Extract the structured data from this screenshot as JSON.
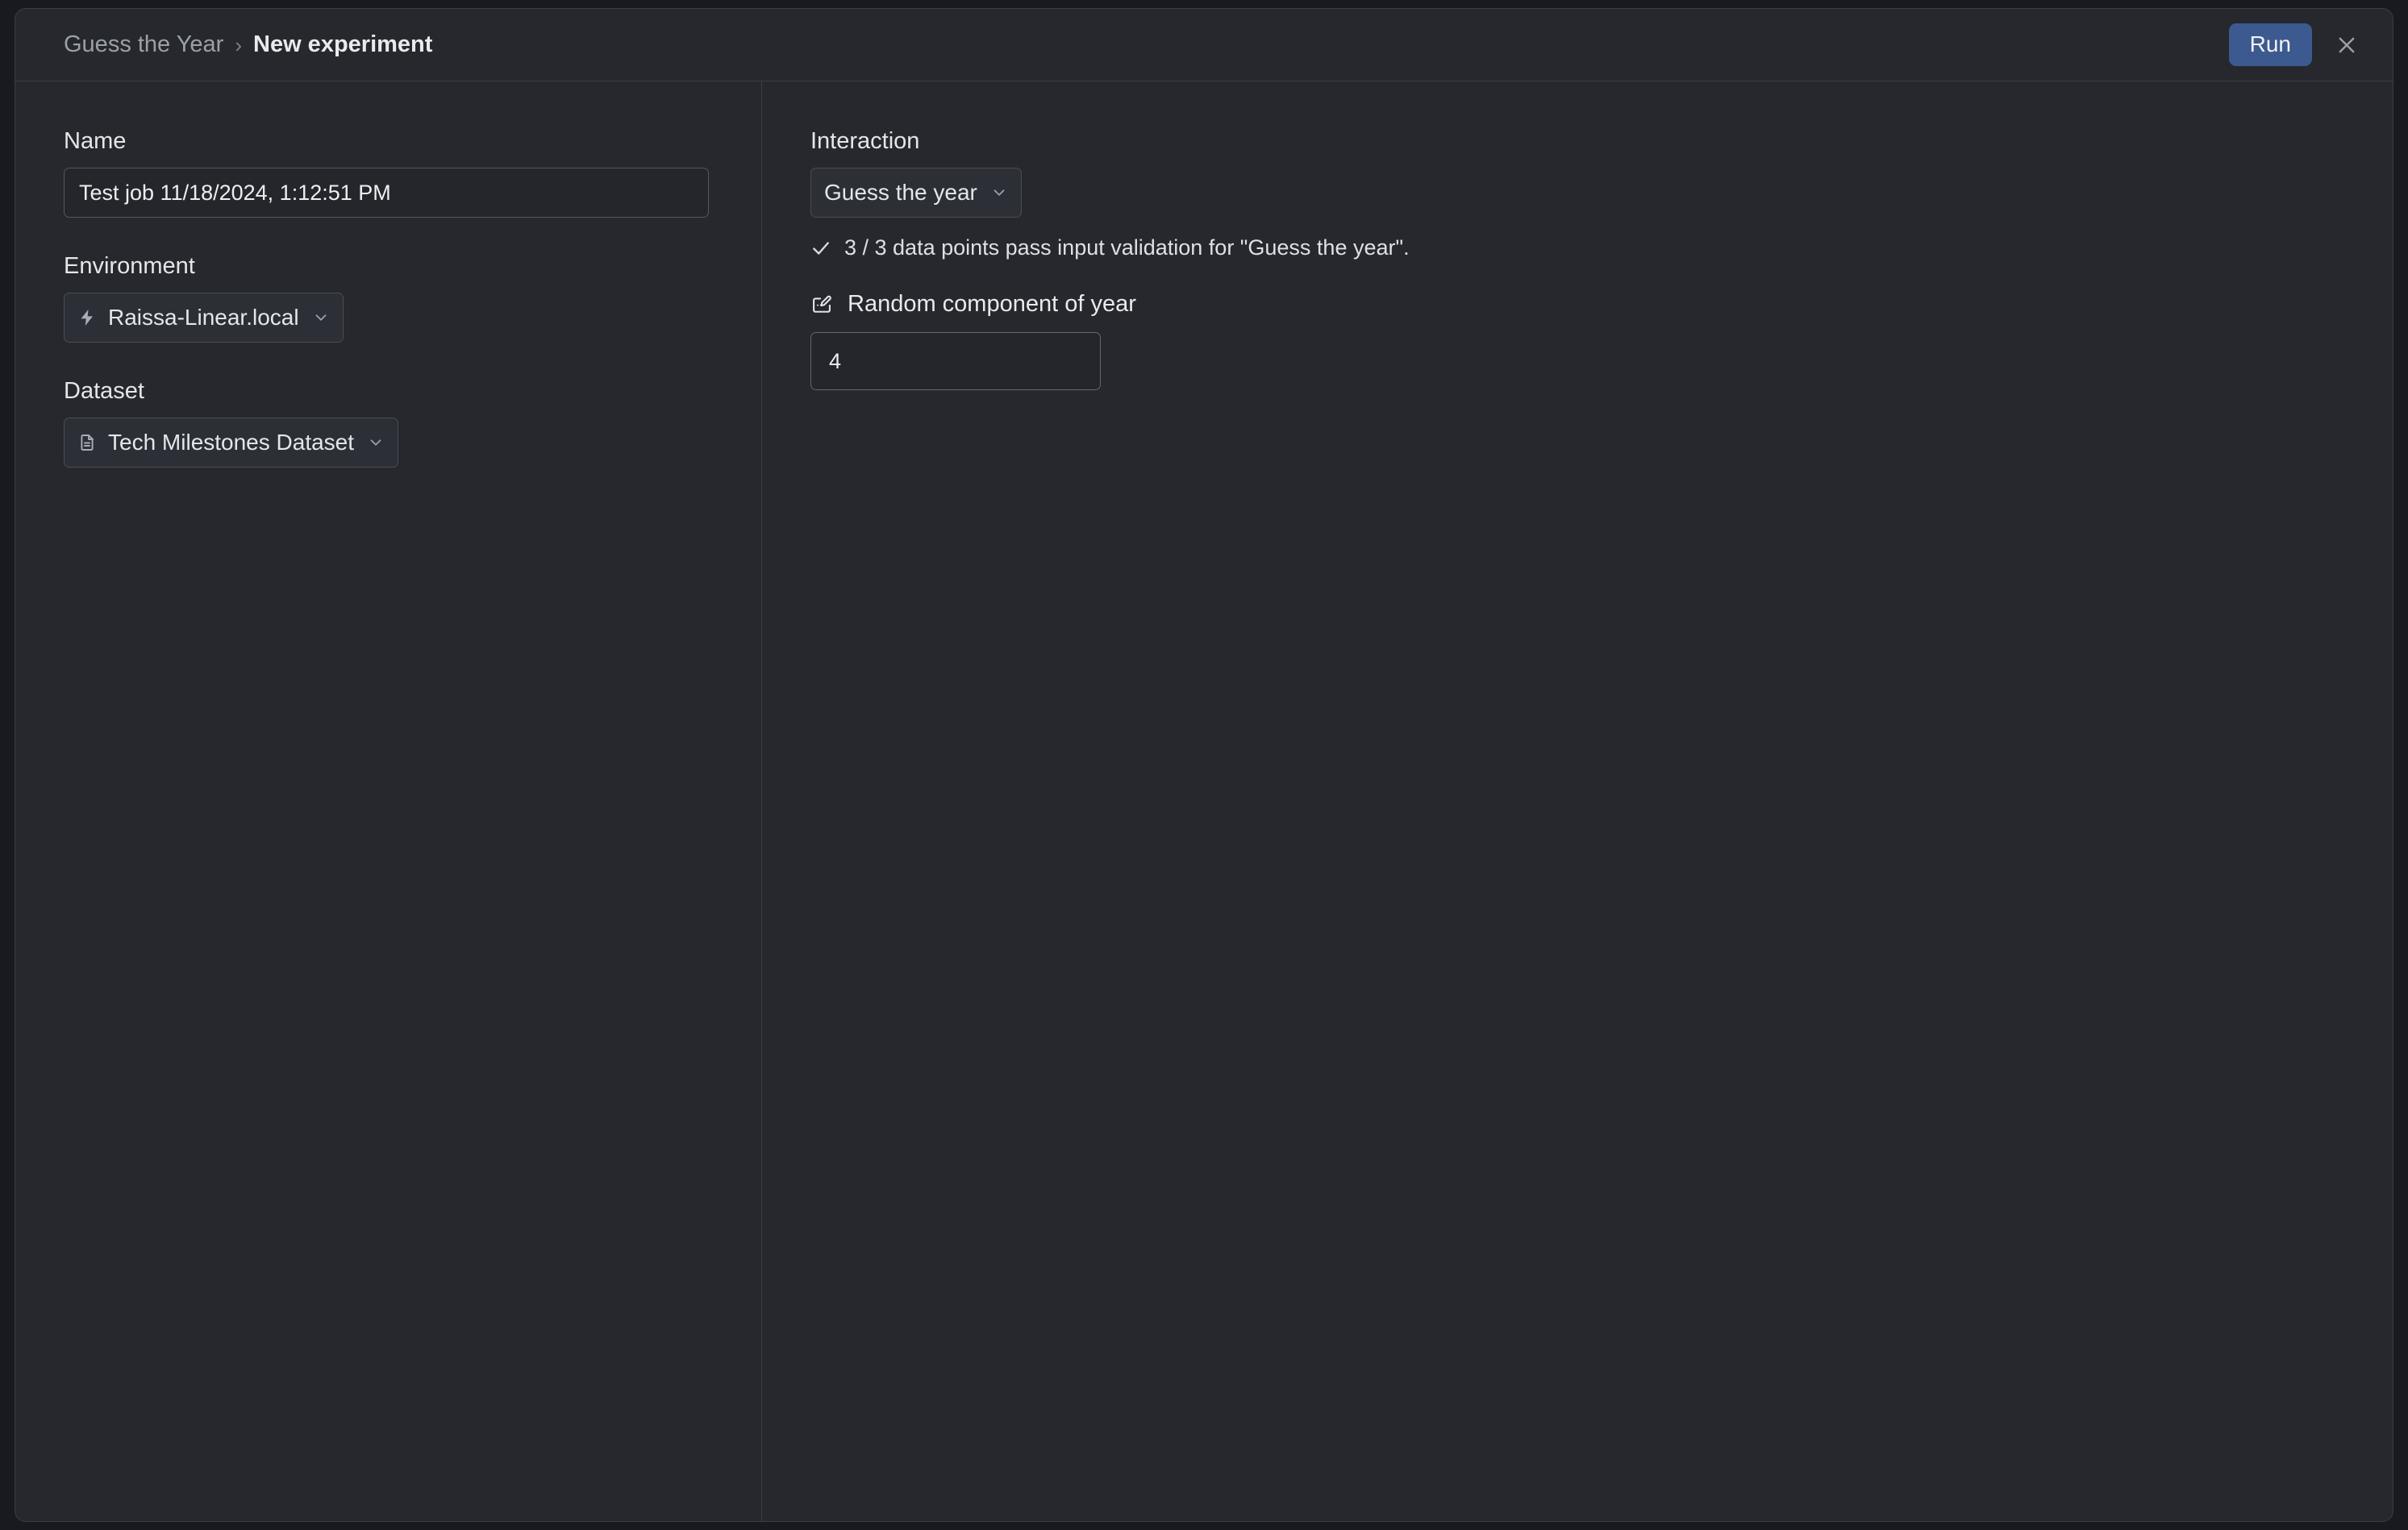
{
  "header": {
    "breadcrumb": {
      "root": "Guess the Year",
      "separator": "›",
      "current": "New experiment"
    },
    "run_label": "Run",
    "close_icon": "close-icon"
  },
  "left_pane": {
    "name_field": {
      "label": "Name",
      "value": "Test job 11/18/2024, 1:12:51 PM",
      "placeholder": "Name"
    },
    "environment_field": {
      "label": "Environment",
      "value": "Raissa-Linear.local",
      "icon": "lightning-bolt-icon",
      "chevron": "chevron-down-icon"
    },
    "dataset_field": {
      "label": "Dataset",
      "value": "Tech Milestones Dataset",
      "icon": "document-icon",
      "chevron": "chevron-down-icon"
    }
  },
  "right_pane": {
    "interaction_field": {
      "label": "Interaction",
      "value": "Guess the year",
      "chevron": "chevron-down-icon"
    },
    "validation": {
      "icon": "check-icon",
      "message": "3 / 3 data points pass input validation for \"Guess the year\"."
    },
    "parameter": {
      "icon": "edit-input-icon",
      "title": "Random component of year",
      "value": "4",
      "placeholder": "0"
    }
  },
  "colors": {
    "page_background": "#181a1f",
    "card_background": "#26282d",
    "border": "#3a3d44",
    "accent_run": "#3c5a8f",
    "text_primary": "#e8eaed",
    "text_muted": "#9aa0a8"
  }
}
